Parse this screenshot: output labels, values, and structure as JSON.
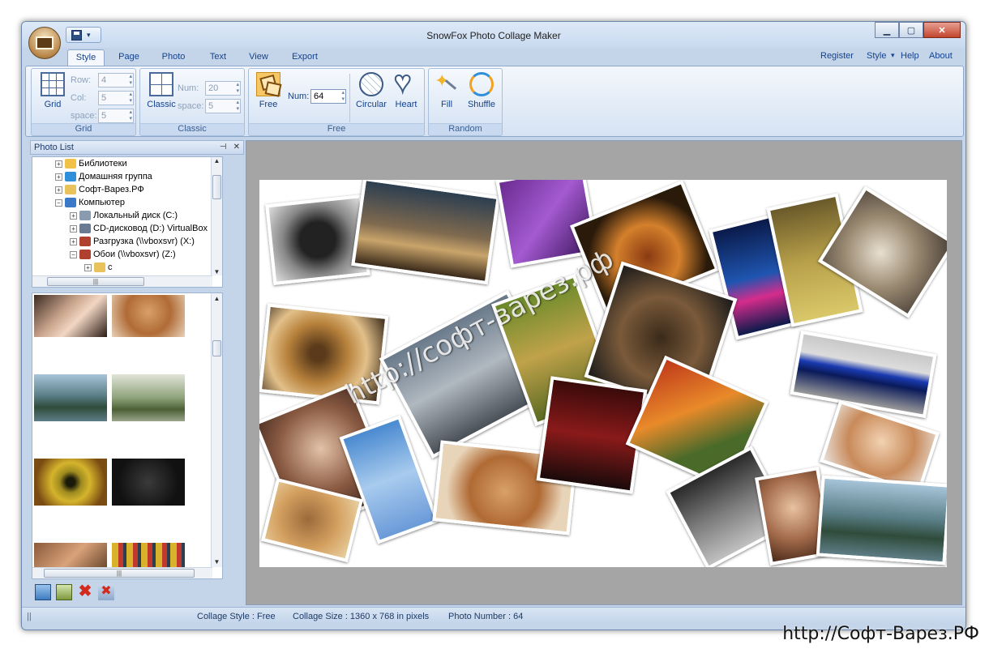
{
  "window": {
    "title": "SnowFox Photo Collage Maker"
  },
  "tabs": [
    "Style",
    "Page",
    "Photo",
    "Text",
    "View",
    "Export"
  ],
  "active_tab": "Style",
  "right_links": [
    "Register",
    "Style",
    "Help",
    "About"
  ],
  "ribbon": {
    "grid": {
      "button": "Grid",
      "row_label": "Row:",
      "row": "4",
      "col_label": "Col:",
      "col": "5",
      "space_label": "space:",
      "space": "5",
      "group": "Grid"
    },
    "classic": {
      "button": "Classic",
      "num_label": "Num:",
      "num": "20",
      "space_label": "space:",
      "space": "5",
      "group": "Classic"
    },
    "free": {
      "button": "Free",
      "num_label": "Num:",
      "num": "64",
      "circular": "Circular",
      "heart": "Heart",
      "group": "Free"
    },
    "random": {
      "fill": "Fill",
      "shuffle": "Shuffle",
      "group": "Random"
    }
  },
  "photo_list": {
    "title": "Photo List",
    "tree": [
      {
        "label": "Библиотеки",
        "indent": 0,
        "expander": "+",
        "icon": "library-icon"
      },
      {
        "label": "Домашняя группа",
        "indent": 0,
        "expander": "+",
        "icon": "homegroup-icon"
      },
      {
        "label": "Софт-Варез.РФ",
        "indent": 0,
        "expander": "+",
        "icon": "folder-icon"
      },
      {
        "label": "Компьютер",
        "indent": 0,
        "expander": "−",
        "icon": "computer-icon"
      },
      {
        "label": "Локальный диск (C:)",
        "indent": 1,
        "expander": "+",
        "icon": "drive-icon"
      },
      {
        "label": "CD-дисковод (D:) VirtualBox",
        "indent": 1,
        "expander": "+",
        "icon": "cd-icon"
      },
      {
        "label": "Разгрузка (\\\\vboxsvr) (X:)",
        "indent": 1,
        "expander": "+",
        "icon": "network-drive-icon"
      },
      {
        "label": "Обои (\\\\vboxsvr) (Z:)",
        "indent": 1,
        "expander": "−",
        "icon": "network-drive-icon"
      },
      {
        "label": "c",
        "indent": 2,
        "expander": "+",
        "icon": "folder-icon"
      }
    ]
  },
  "status": {
    "style": "Collage Style : Free",
    "size": "Collage Size : 1360 x 768  in pixels",
    "number": "Photo Number : 64"
  },
  "watermark": "http://софт-варез.рф",
  "site_link": "http://Софт-Варез.РФ",
  "colors": {
    "accent": "#15428b",
    "ribbon": "#dae6f5",
    "canvas_bg": "#a5a5a5"
  }
}
